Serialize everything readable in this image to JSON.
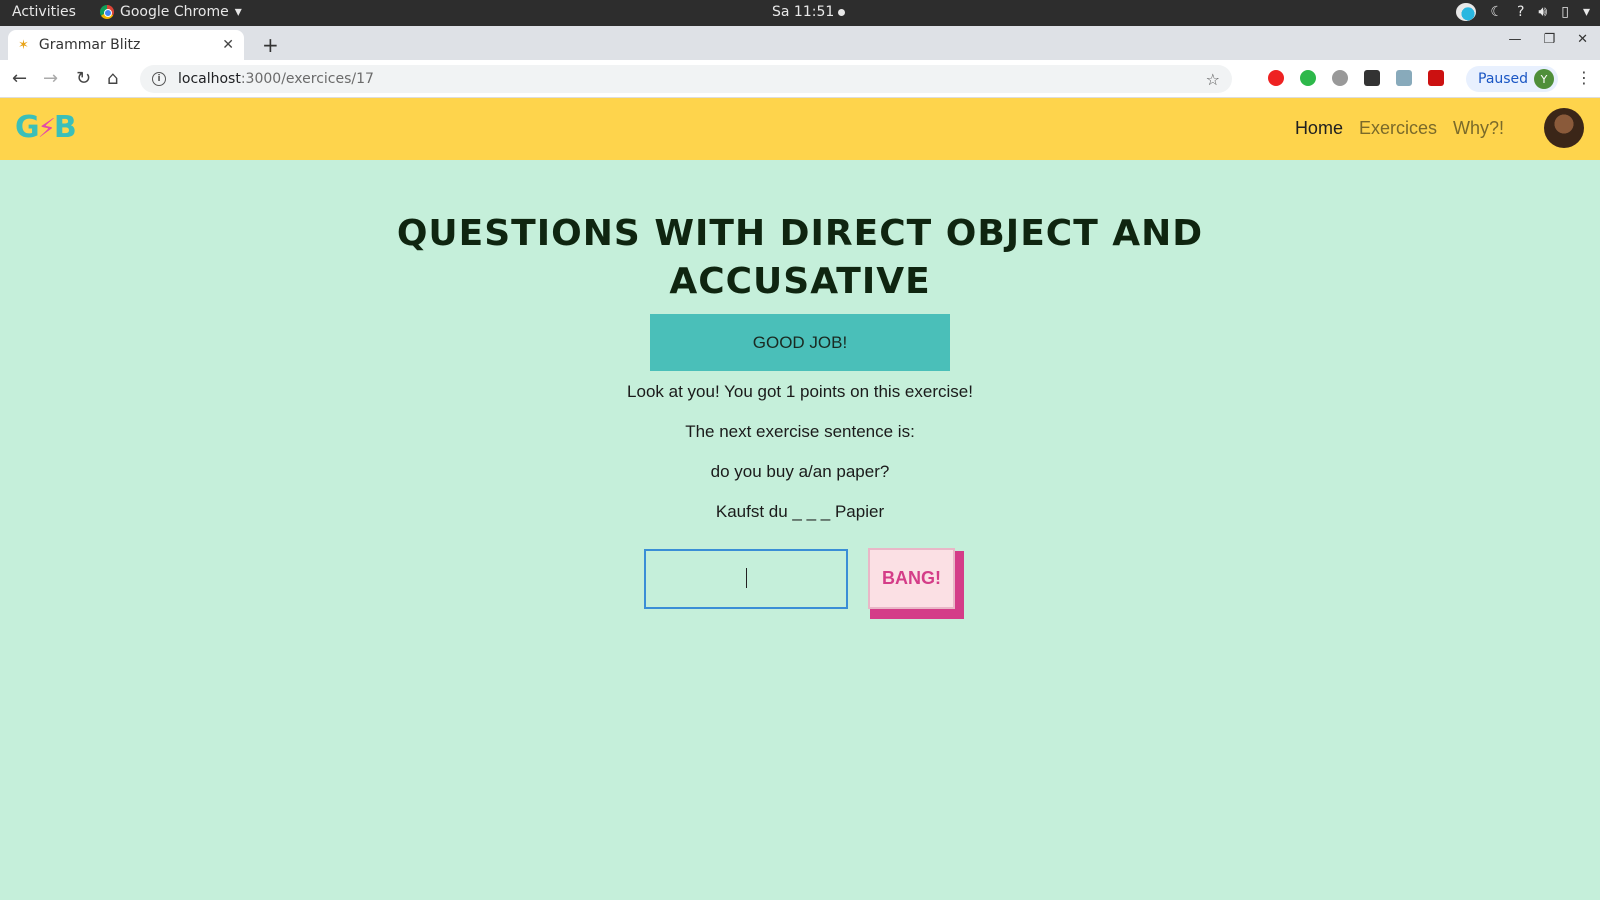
{
  "os_bar": {
    "activities": "Activities",
    "app_name": "Google Chrome",
    "clock": "Sa 11:51",
    "tray_icons": [
      "weather-icon",
      "night-light-icon",
      "help-icon",
      "volume-icon",
      "battery-icon",
      "chevron-down-icon"
    ]
  },
  "browser": {
    "tab_title": "Grammar Blitz",
    "url_host": "localhost",
    "url_path": ":3000/exercices/17",
    "profile_status": "Paused",
    "profile_initial": "Y"
  },
  "site": {
    "logo_left": "G",
    "logo_bolt": "⚡",
    "logo_right": "B",
    "nav": {
      "home": "Home",
      "exercices": "Exercices",
      "why": "Why?!"
    }
  },
  "exercise": {
    "title": "Questions with direct object and accusative",
    "result_banner": "GOOD JOB!",
    "score_text": "Look at you! You got 1 points on this exercise!",
    "next_label": "The next exercise sentence is:",
    "english_sentence": "do you buy a/an paper?",
    "german_sentence": "Kaufst du _ _ _ Papier",
    "answer_value": "",
    "submit_label": "BANG!"
  },
  "colors": {
    "page_bg": "#c5efda",
    "header_bg": "#fed44c",
    "banner_bg": "#4abfb9",
    "accent_pink": "#d43d88",
    "input_border": "#3a8ed6"
  }
}
